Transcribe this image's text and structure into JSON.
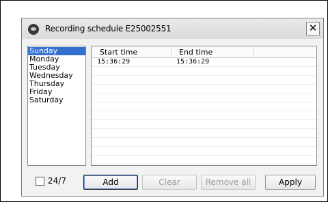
{
  "window": {
    "title": "Recording schedule E25002551",
    "close_glyph": "✕"
  },
  "days": [
    "Sunday",
    "Monday",
    "Tuesday",
    "Wednesday",
    "Thursday",
    "Friday",
    "Saturday"
  ],
  "selected_day": "Sunday",
  "table": {
    "columns": [
      "Start time",
      "End time",
      ""
    ],
    "rows": [
      {
        "start": "15:36:29",
        "end": "15:36:29"
      }
    ],
    "empty_rows": 11
  },
  "footer": {
    "always_label": "24/7",
    "always_checked": false,
    "add_label": "Add",
    "clear_label": "Clear",
    "remove_all_label": "Remove all",
    "apply_label": "Apply"
  },
  "colors": {
    "selection": "#3470d0",
    "dialog_bg": "#f2f2f2"
  }
}
